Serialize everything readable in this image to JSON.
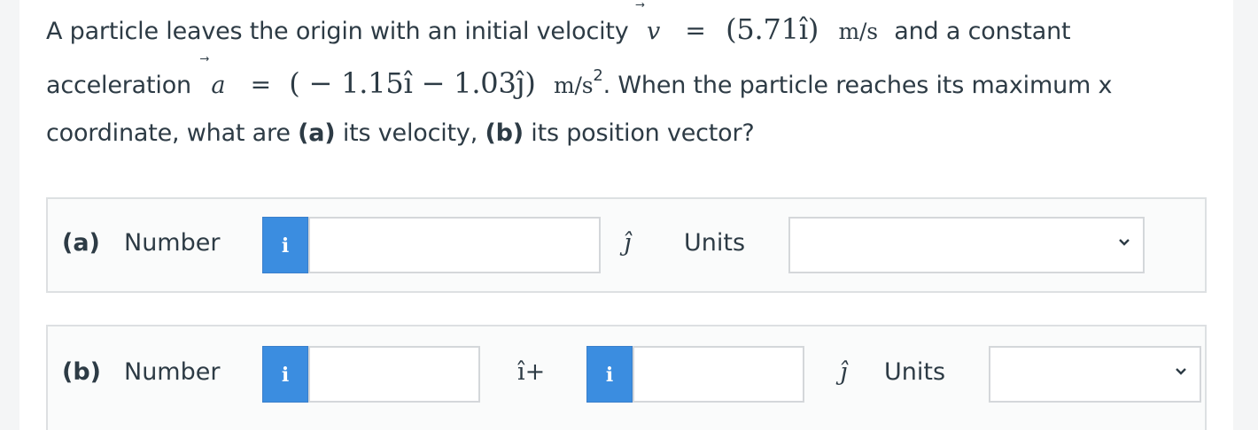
{
  "question": {
    "p1": "A particle leaves the origin with an initial velocity",
    "v_symbol": "v",
    "eq": "=",
    "v_value": "(5.71î)",
    "v_unit": "m/s",
    "p2": "and a constant",
    "p3": "acceleration",
    "a_symbol": "a",
    "a_value": "( − 1.15î − 1.03ĵ)",
    "a_unit": "m/s",
    "a_exp": "2",
    "p4": ". When the particle reaches its maximum x",
    "p5": "coordinate, what are",
    "part_a_tag": "(a)",
    "p6": "its velocity,",
    "part_b_tag": "(b)",
    "p7": "its position vector?"
  },
  "part_a": {
    "label": "(a)",
    "number_label": "Number",
    "info": "i",
    "value": "",
    "unit_vector": "ĵ",
    "units_label": "Units",
    "units_selected": ""
  },
  "part_b": {
    "label": "(b)",
    "number_label": "Number",
    "info1": "i",
    "value1": "",
    "i_plus": "î+",
    "info2": "i",
    "value2": "",
    "unit_vector": "ĵ",
    "units_label": "Units",
    "units_selected": ""
  },
  "colors": {
    "info_button": "#3b8de0",
    "panel_border": "#dde0e2",
    "text": "#2d3b45"
  },
  "icons": {
    "info": "info-icon",
    "dropdown": "chevron-down-icon"
  }
}
